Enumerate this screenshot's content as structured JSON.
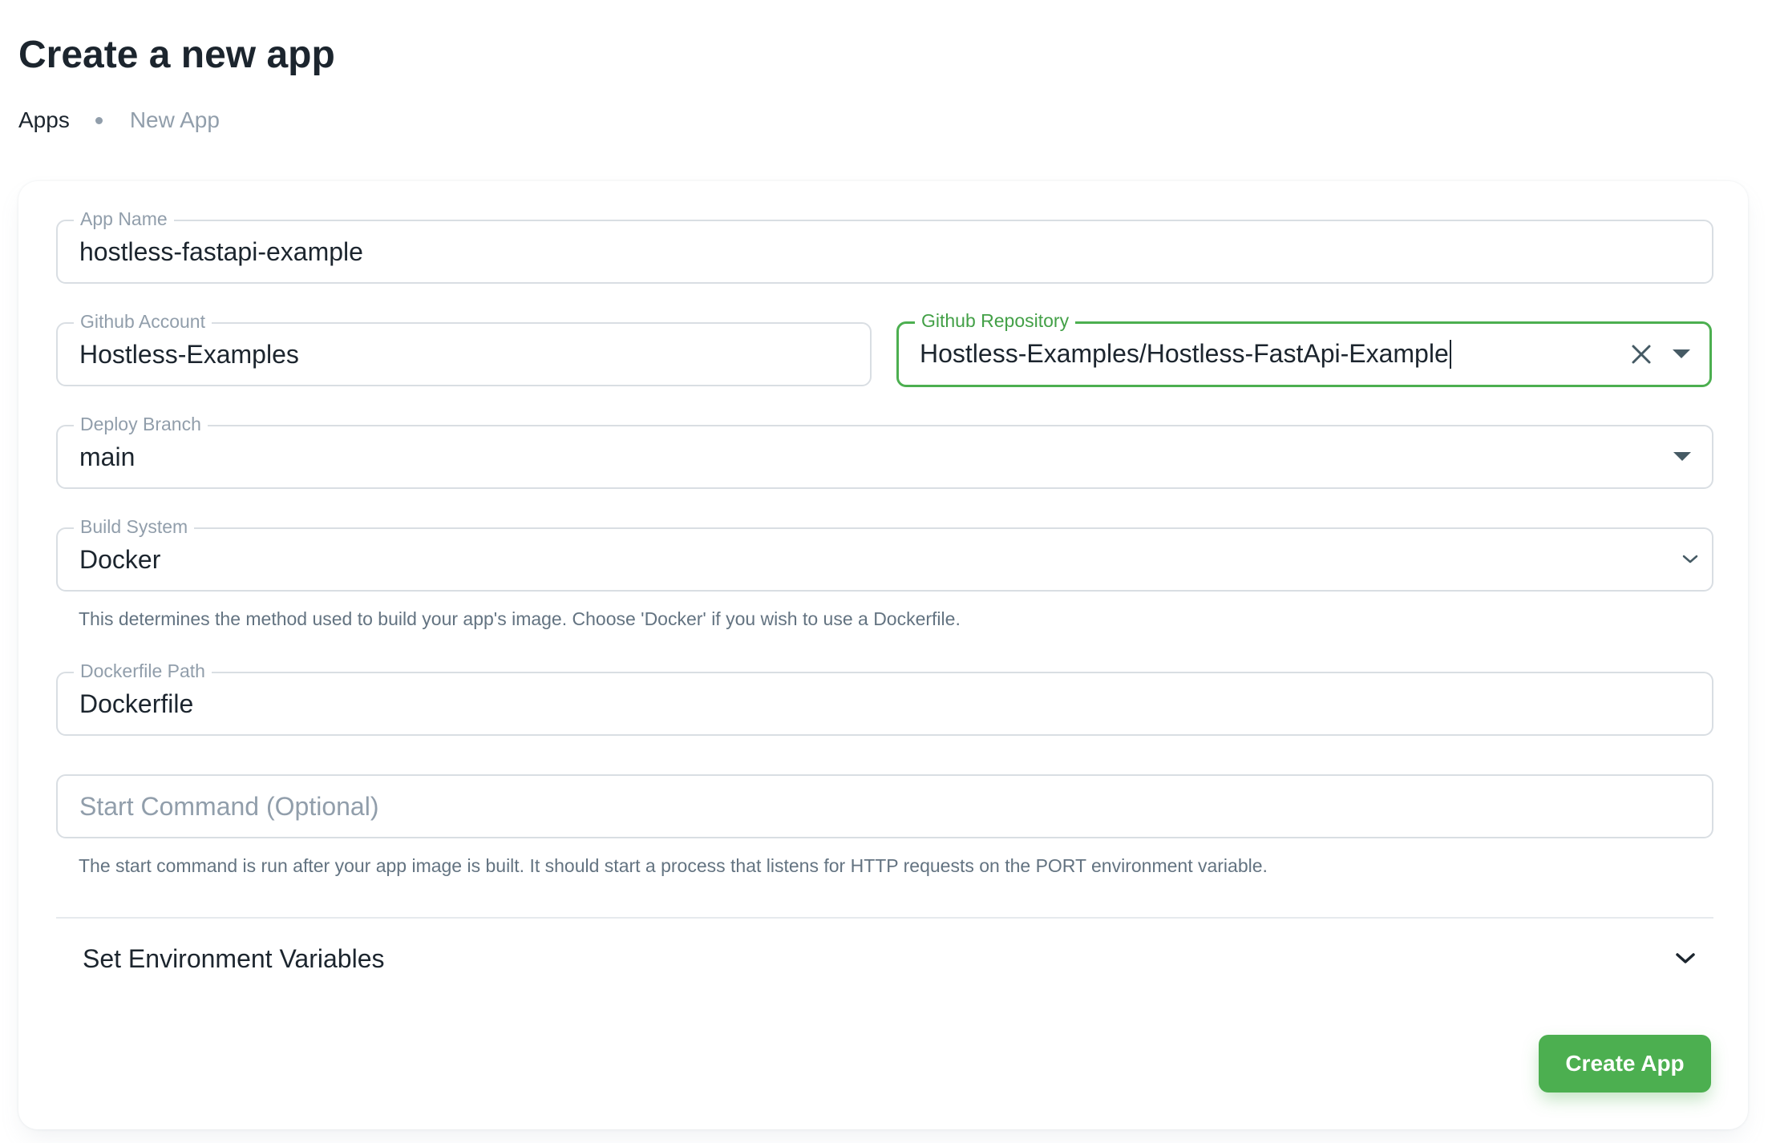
{
  "page": {
    "title": "Create a new app",
    "breadcrumb": [
      {
        "label": "Apps"
      },
      {
        "label": "New App"
      }
    ]
  },
  "form": {
    "app_name": {
      "label": "App Name",
      "value": "hostless-fastapi-example"
    },
    "github_account": {
      "label": "Github Account",
      "value": "Hostless-Examples"
    },
    "github_repository": {
      "label": "Github Repository",
      "value": "Hostless-Examples/Hostless-FastApi-Example",
      "clear_icon": "close-icon",
      "dropdown_icon": "caret-down-icon"
    },
    "deploy_branch": {
      "label": "Deploy Branch",
      "value": "main",
      "dropdown_icon": "caret-down-icon"
    },
    "build_system": {
      "label": "Build System",
      "value": "Docker",
      "dropdown_icon": "chevron-down-icon",
      "helper": "This determines the method used to build your app's image. Choose 'Docker' if you wish to use a Dockerfile."
    },
    "dockerfile_path": {
      "label": "Dockerfile Path",
      "value": "Dockerfile"
    },
    "start_command": {
      "placeholder": "Start Command (Optional)",
      "value": "",
      "helper": "The start command is run after your app image is built. It should start a process that listens for HTTP requests on the PORT environment variable."
    },
    "env_vars": {
      "label": "Set Environment Variables",
      "icon": "chevron-down-icon"
    },
    "submit_label": "Create App"
  },
  "colors": {
    "accent": "#4caf50",
    "focused_label": "#43a047",
    "text_primary": "#1c252e",
    "text_secondary": "#637381",
    "text_disabled": "#919eab",
    "border": "#d9dee3"
  }
}
